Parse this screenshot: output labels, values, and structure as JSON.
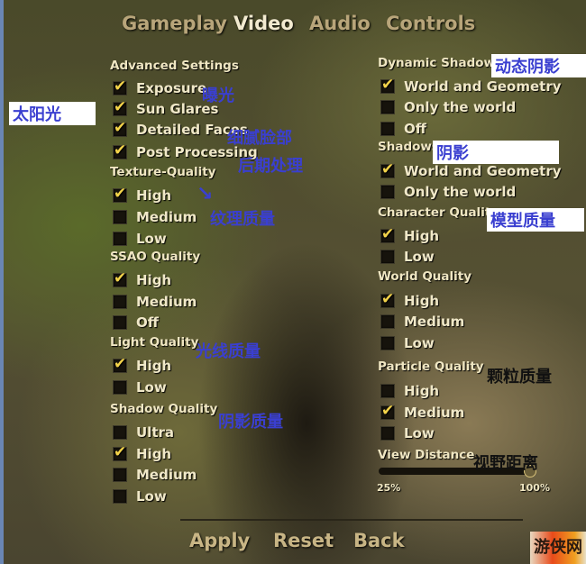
{
  "tabs": [
    {
      "label": "Gameplay",
      "active": false
    },
    {
      "label": "Video",
      "active": true
    },
    {
      "label": "Audio",
      "active": false
    },
    {
      "label": "Controls",
      "active": false
    }
  ],
  "left_column": [
    {
      "type": "header",
      "label": "Advanced Settings"
    },
    {
      "type": "option",
      "label": "Exposure",
      "checked": true
    },
    {
      "type": "option",
      "label": "Sun Glares",
      "checked": true
    },
    {
      "type": "option",
      "label": "Detailed Faces",
      "checked": true
    },
    {
      "type": "option",
      "label": "Post Processing",
      "checked": true
    },
    {
      "type": "header",
      "label": "Texture-Quality"
    },
    {
      "type": "option",
      "label": "High",
      "checked": true
    },
    {
      "type": "option",
      "label": "Medium",
      "checked": false
    },
    {
      "type": "option",
      "label": "Low",
      "checked": false
    },
    {
      "type": "header",
      "label": "SSAO Quality"
    },
    {
      "type": "option",
      "label": "High",
      "checked": true
    },
    {
      "type": "option",
      "label": "Medium",
      "checked": false
    },
    {
      "type": "option",
      "label": "Off",
      "checked": false
    },
    {
      "type": "header",
      "label": "Light Quality"
    },
    {
      "type": "option",
      "label": "High",
      "checked": true
    },
    {
      "type": "option",
      "label": "Low",
      "checked": false
    },
    {
      "type": "header",
      "label": "Shadow Quality"
    },
    {
      "type": "option",
      "label": "Ultra",
      "checked": false
    },
    {
      "type": "option",
      "label": "High",
      "checked": true
    },
    {
      "type": "option",
      "label": "Medium",
      "checked": false
    },
    {
      "type": "option",
      "label": "Low",
      "checked": false
    }
  ],
  "right_column": [
    {
      "type": "header",
      "label": "Dynamic Shadows"
    },
    {
      "type": "option",
      "label": "World and Geometry",
      "checked": true
    },
    {
      "type": "option",
      "label": "Only the world",
      "checked": false
    },
    {
      "type": "option",
      "label": "Off",
      "checked": false
    },
    {
      "type": "header",
      "label": "Shadows"
    },
    {
      "type": "option",
      "label": "World and Geometry",
      "checked": true
    },
    {
      "type": "option",
      "label": "Only the world",
      "checked": false
    },
    {
      "type": "header",
      "label": "Character Quality"
    },
    {
      "type": "option",
      "label": "High",
      "checked": true
    },
    {
      "type": "option",
      "label": "Low",
      "checked": false
    },
    {
      "type": "header",
      "label": "World Quality"
    },
    {
      "type": "option",
      "label": "High",
      "checked": true
    },
    {
      "type": "option",
      "label": "Medium",
      "checked": false
    },
    {
      "type": "option",
      "label": "Low",
      "checked": false
    },
    {
      "type": "header",
      "label": "Particle Quality"
    },
    {
      "type": "option",
      "label": "High",
      "checked": false
    },
    {
      "type": "option",
      "label": "Medium",
      "checked": true
    },
    {
      "type": "option",
      "label": "Low",
      "checked": false
    }
  ],
  "view_distance": {
    "label": "View Distance",
    "min_label": "25%",
    "max_label": "100%",
    "value_percent": 100
  },
  "buttons": {
    "apply": "Apply",
    "reset": "Reset",
    "back": "Back"
  },
  "annotations": {
    "sunlight": "太阳光",
    "exposure": "曝光",
    "detailed_faces": "细腻脸部",
    "post_processing": "后期处理",
    "arrow": "↘",
    "texture_quality": "纹理质量",
    "light_quality": "光线质量",
    "shadow_quality": "阴影质量",
    "dynamic_shadows": "动态阴影",
    "shadows": "阴影",
    "character_quality": "模型质量",
    "particle_quality": "颗粒质量",
    "view_distance": "视野距离"
  },
  "watermark": "游侠网",
  "colors": {
    "annotation_blue": "#3a3fd0",
    "check_yellow": "#f3d34a",
    "active_tab": "#f2ead0",
    "inactive_tab": "#b8a57a"
  }
}
